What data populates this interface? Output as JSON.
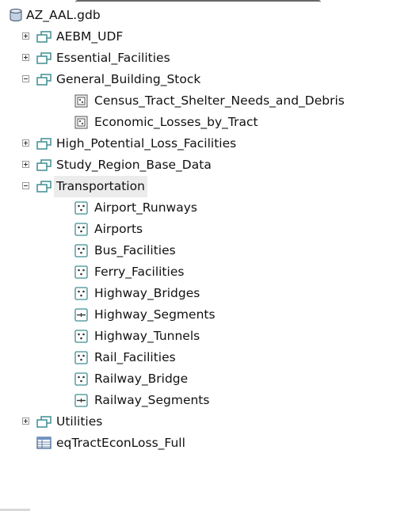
{
  "window": {
    "root_label": "AZ_AAL.gdb"
  },
  "tree": {
    "aebm_udf": {
      "label": "AEBM_UDF",
      "expanded": false
    },
    "essential_facilities": {
      "label": "Essential_Facilities",
      "expanded": false
    },
    "general_building_stock": {
      "label": "General_Building_Stock",
      "expanded": true,
      "children": [
        {
          "label": "Census_Tract_Shelter_Needs_and_Debris",
          "type": "raster"
        },
        {
          "label": "Economic_Losses_by_Tract",
          "type": "raster"
        }
      ]
    },
    "high_potential_loss_facilities": {
      "label": "High_Potential_Loss_Facilities",
      "expanded": false
    },
    "study_region_base_data": {
      "label": "Study_Region_Base_Data",
      "expanded": false
    },
    "transportation": {
      "label": "Transportation",
      "expanded": true,
      "selected": true,
      "children": [
        {
          "label": "Airport_Runways",
          "type": "point"
        },
        {
          "label": "Airports",
          "type": "point"
        },
        {
          "label": "Bus_Facilities",
          "type": "point"
        },
        {
          "label": "Ferry_Facilities",
          "type": "point"
        },
        {
          "label": "Highway_Bridges",
          "type": "point"
        },
        {
          "label": "Highway_Segments",
          "type": "line"
        },
        {
          "label": "Highway_Tunnels",
          "type": "point"
        },
        {
          "label": "Rail_Facilities",
          "type": "point"
        },
        {
          "label": "Railway_Bridge",
          "type": "point"
        },
        {
          "label": "Railway_Segments",
          "type": "line"
        }
      ]
    },
    "utilities": {
      "label": "Utilities",
      "expanded": false
    },
    "eq_table": {
      "label": "eqTractEconLoss_Full",
      "type": "table"
    }
  },
  "icons": {
    "database": "database-icon",
    "dataset": "feature-dataset-icon",
    "raster": "raster-class-icon",
    "point": "point-feature-class-icon",
    "line": "line-feature-class-icon",
    "table": "table-icon"
  },
  "colors": {
    "icon_teal": "#3f8d92",
    "selected_bg": "#ececec",
    "text": "#111111"
  }
}
